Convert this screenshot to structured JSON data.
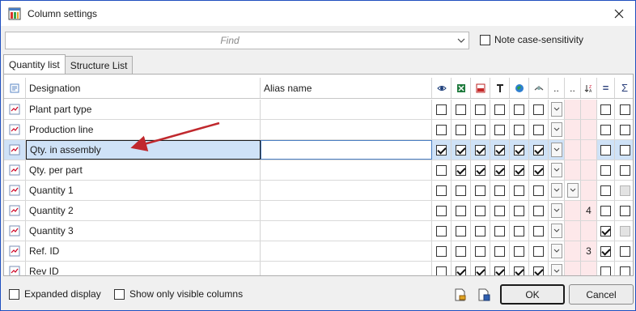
{
  "window": {
    "title": "Column settings",
    "icon": "column-settings-app-icon",
    "close_icon": "close-icon"
  },
  "find": {
    "placeholder": "Find",
    "value": "",
    "dropdown_icon": "chevron-down-icon"
  },
  "note_case": {
    "label": "Note case-sensitivity",
    "checked": false
  },
  "tabs": [
    {
      "label": "Quantity list",
      "active": true
    },
    {
      "label": "Structure List",
      "active": false
    }
  ],
  "grid": {
    "headers": {
      "icon": "list-header-icon",
      "designation": "Designation",
      "alias": "Alias name",
      "visible_icon": "eye-icon",
      "excel_icon": "excel-icon",
      "pdf_icon": "pdf-icon",
      "text_icon": "text-icon",
      "globe_icon": "globe-icon",
      "filter_icon": "filter-icon",
      "dots1": "..",
      "dots2": "..",
      "sort_icon": "sort-icon",
      "equal_icon": "=",
      "sum_icon": "Σ"
    },
    "rows": [
      {
        "designation": "Plant part type",
        "alias": "",
        "checks": [
          false,
          false,
          false,
          false,
          false,
          false
        ],
        "num": "",
        "eq": false,
        "sum": false,
        "sumDisabled": false,
        "extraDropdown": false,
        "selected": false
      },
      {
        "designation": "Production line",
        "alias": "",
        "checks": [
          false,
          false,
          false,
          false,
          false,
          false
        ],
        "num": "",
        "eq": false,
        "sum": false,
        "sumDisabled": false,
        "extraDropdown": false,
        "selected": false
      },
      {
        "designation": "Qty. in assembly",
        "alias": "",
        "checks": [
          true,
          true,
          true,
          true,
          true,
          true
        ],
        "num": "",
        "eq": false,
        "sum": false,
        "sumDisabled": false,
        "extraDropdown": false,
        "selected": true
      },
      {
        "designation": "Qty. per part",
        "alias": "",
        "checks": [
          false,
          true,
          true,
          true,
          true,
          true
        ],
        "num": "",
        "eq": false,
        "sum": false,
        "sumDisabled": false,
        "extraDropdown": false,
        "selected": false
      },
      {
        "designation": "Quantity 1",
        "alias": "",
        "checks": [
          false,
          false,
          false,
          false,
          false,
          false
        ],
        "num": "",
        "eq": false,
        "sum": false,
        "sumDisabled": true,
        "extraDropdown": true,
        "selected": false
      },
      {
        "designation": "Quantity 2",
        "alias": "",
        "checks": [
          false,
          false,
          false,
          false,
          false,
          false
        ],
        "num": "4",
        "eq": false,
        "sum": false,
        "sumDisabled": false,
        "extraDropdown": false,
        "selected": false
      },
      {
        "designation": "Quantity 3",
        "alias": "",
        "checks": [
          false,
          false,
          false,
          false,
          false,
          false
        ],
        "num": "",
        "eq": true,
        "sum": false,
        "sumDisabled": true,
        "extraDropdown": false,
        "selected": false
      },
      {
        "designation": "Ref. ID",
        "alias": "",
        "checks": [
          false,
          false,
          false,
          false,
          false,
          false
        ],
        "num": "3",
        "eq": true,
        "sum": false,
        "sumDisabled": false,
        "extraDropdown": false,
        "selected": false
      },
      {
        "designation": "Rev ID",
        "alias": "",
        "checks": [
          false,
          true,
          true,
          true,
          true,
          true
        ],
        "num": "",
        "eq": false,
        "sum": false,
        "sumDisabled": false,
        "extraDropdown": false,
        "selected": false
      }
    ]
  },
  "footer": {
    "expanded_display": {
      "label": "Expanded display",
      "checked": false
    },
    "show_visible": {
      "label": "Show only visible columns",
      "checked": false
    },
    "load_icon": "load-settings-icon",
    "save_icon": "save-settings-icon",
    "ok_label": "OK",
    "cancel_label": "Cancel"
  },
  "colors": {
    "accent_border": "#1f4fbf",
    "selected_row": "#cfe2f7",
    "pink_cell": "#fde8ea",
    "arrow": "#c0282d"
  }
}
